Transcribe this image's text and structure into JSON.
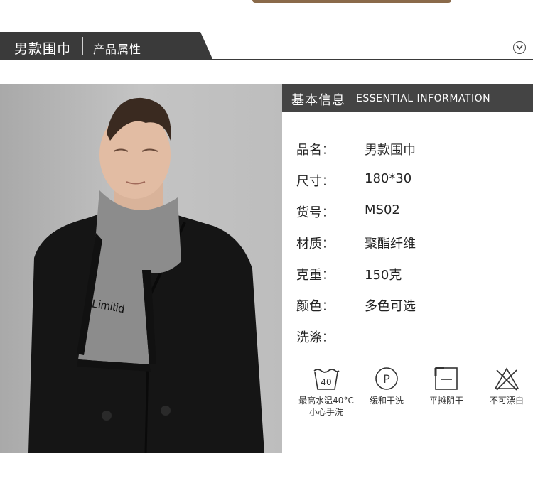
{
  "header": {
    "title": "男款围巾",
    "subtitle": "产品属性"
  },
  "photo": {
    "scarf_text": "Limitid"
  },
  "info": {
    "heading_zh": "基本信息",
    "heading_en": "ESSENTIAL INFORMATION",
    "rows": [
      {
        "label": "品名：",
        "value": "男款围巾"
      },
      {
        "label": "尺寸：",
        "value": "180*30"
      },
      {
        "label": "货号：",
        "value": "MS02"
      },
      {
        "label": "材质：",
        "value": "聚酯纤维"
      },
      {
        "label": "克重：",
        "value": "150克"
      },
      {
        "label": "颜色：",
        "value": "多色可选"
      },
      {
        "label": "洗涤：",
        "value": ""
      }
    ]
  },
  "care": [
    {
      "icon": "wash-40-icon",
      "label1": "最高水温40°C",
      "label2": "小心手洗",
      "tub_text": "40"
    },
    {
      "icon": "dry-clean-p-icon",
      "label1": "缓和干洗",
      "label2": "",
      "circle_text": "P"
    },
    {
      "icon": "flat-dry-shade-icon",
      "label1": "平摊阴干",
      "label2": ""
    },
    {
      "icon": "no-bleach-icon",
      "label1": "不可漂白",
      "label2": ""
    }
  ]
}
